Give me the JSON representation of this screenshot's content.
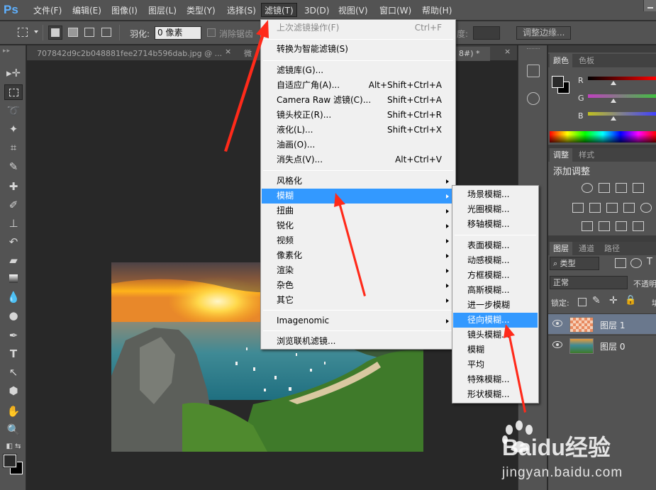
{
  "app": {
    "logo": "Ps",
    "menubar": [
      "文件(F)",
      "编辑(E)",
      "图像(I)",
      "图层(L)",
      "类型(Y)",
      "选择(S)",
      "滤镜(T)",
      "3D(D)",
      "视图(V)",
      "窗口(W)",
      "帮助(H)"
    ],
    "active_menu": "滤镜(T)"
  },
  "options": {
    "feather_label": "羽化:",
    "feather_value": "0 像素",
    "antialias_label": "消除锯齿",
    "density_label": "度:",
    "refine_button": "调整边缘..."
  },
  "tabs": {
    "doc1": "707842d9c2b048881fee2714b596dab.jpg @ ...",
    "doc1_close": "×",
    "doc2": "微",
    "doc2_suffix": "8#) *",
    "doc2_close": "×"
  },
  "filter_menu": {
    "last_filter": "上次滤镜操作(F)",
    "last_filter_shortcut": "Ctrl+F",
    "convert_smart": "转换为智能滤镜(S)",
    "gallery": "滤镜库(G)...",
    "adaptive_wide": "自适应广角(A)...",
    "adaptive_wide_shortcut": "Alt+Shift+Ctrl+A",
    "camera_raw": "Camera Raw 滤镜(C)...",
    "camera_raw_shortcut": "Shift+Ctrl+A",
    "lens_correction": "镜头校正(R)...",
    "lens_correction_shortcut": "Shift+Ctrl+R",
    "liquify": "液化(L)...",
    "liquify_shortcut": "Shift+Ctrl+X",
    "oil_paint": "油画(O)...",
    "vanishing_point": "消失点(V)...",
    "vanishing_point_shortcut": "Alt+Ctrl+V",
    "stylize": "风格化",
    "blur": "模糊",
    "distort": "扭曲",
    "sharpen": "锐化",
    "video": "视频",
    "pixelate": "像素化",
    "render": "渲染",
    "noise": "杂色",
    "other": "其它",
    "imagenomic": "Imagenomic",
    "browse_online": "浏览联机滤镜..."
  },
  "blur_menu": {
    "field_blur": "场景模糊...",
    "iris_blur": "光圈模糊...",
    "tilt_shift": "移轴模糊...",
    "surface_blur": "表面模糊...",
    "motion_blur": "动感模糊...",
    "box_blur": "方框模糊...",
    "gaussian_blur": "高斯模糊...",
    "blur_more": "进一步模糊",
    "radial_blur": "径向模糊...",
    "lens_blur": "镜头模糊...",
    "blur": "模糊",
    "average": "平均",
    "smart_blur": "特殊模糊...",
    "shape_blur": "形状模糊..."
  },
  "color_panel": {
    "tab_color": "颜色",
    "tab_swatches": "色板",
    "r_label": "R",
    "g_label": "G",
    "b_label": "B"
  },
  "adjust_panel": {
    "tab_adjust": "调整",
    "tab_styles": "样式",
    "title": "添加调整"
  },
  "layers_panel": {
    "tab_layers": "图层",
    "tab_channels": "通道",
    "tab_paths": "路径",
    "filter_kind": "类型",
    "blend_mode": "正常",
    "opacity_label": "不透明",
    "lock_label": "锁定:",
    "fill_label": "填",
    "layers": [
      {
        "name": "图层 1"
      },
      {
        "name": "图层 0"
      }
    ]
  },
  "watermark": {
    "brand": "Baidu经验",
    "url": "jingyan.baidu.com"
  },
  "colors": {
    "menu_highlight": "#3399ff",
    "annotation_red": "#ff2a1a"
  }
}
